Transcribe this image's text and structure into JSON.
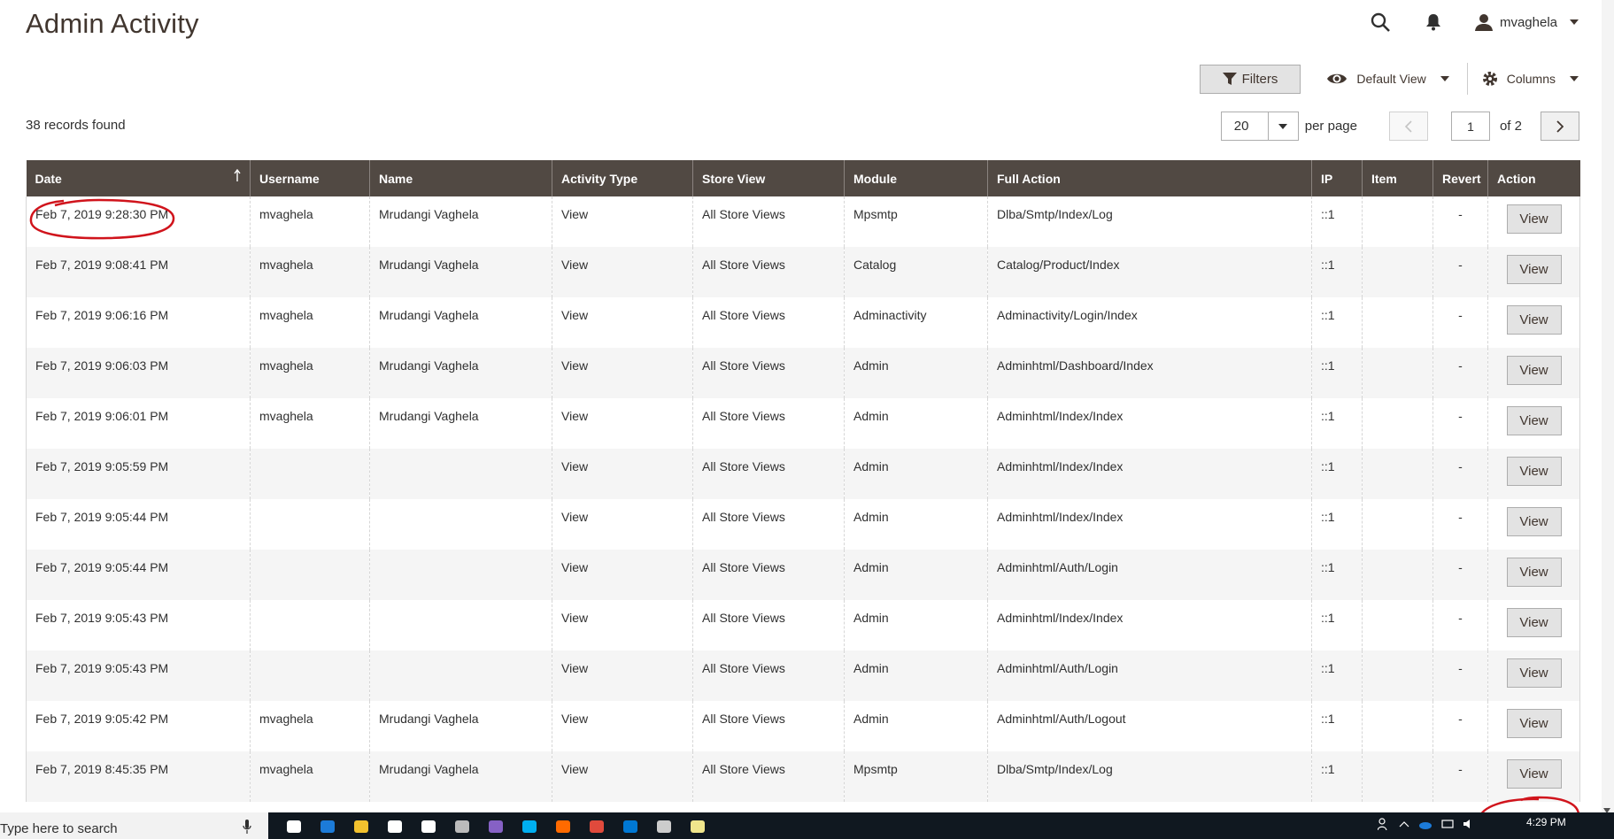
{
  "header": {
    "title": "Admin Activity",
    "username": "mvaghela"
  },
  "toolbar": {
    "filters_label": "Filters",
    "view_label": "Default View",
    "columns_label": "Columns"
  },
  "records_found": "38 records found",
  "pager": {
    "per_page_value": "20",
    "per_page_label": "per page",
    "current_page": "1",
    "of_label": "of 2"
  },
  "table": {
    "columns": [
      "Date",
      "Username",
      "Name",
      "Activity Type",
      "Store View",
      "Module",
      "Full Action",
      "IP",
      "Item",
      "Revert",
      "Action"
    ],
    "action_label": "View",
    "rows": [
      {
        "date": "Feb 7, 2019 9:28:30 PM",
        "username": "mvaghela",
        "name": "Mrudangi Vaghela",
        "type": "View",
        "store": "All Store Views",
        "module": "Mpsmtp",
        "action": "Dlba/Smtp/Index/Log",
        "ip": "::1",
        "item": "",
        "revert": "-"
      },
      {
        "date": "Feb 7, 2019 9:08:41 PM",
        "username": "mvaghela",
        "name": "Mrudangi Vaghela",
        "type": "View",
        "store": "All Store Views",
        "module": "Catalog",
        "action": "Catalog/Product/Index",
        "ip": "::1",
        "item": "",
        "revert": "-"
      },
      {
        "date": "Feb 7, 2019 9:06:16 PM",
        "username": "mvaghela",
        "name": "Mrudangi Vaghela",
        "type": "View",
        "store": "All Store Views",
        "module": "Adminactivity",
        "action": "Adminactivity/Login/Index",
        "ip": "::1",
        "item": "",
        "revert": "-"
      },
      {
        "date": "Feb 7, 2019 9:06:03 PM",
        "username": "mvaghela",
        "name": "Mrudangi Vaghela",
        "type": "View",
        "store": "All Store Views",
        "module": "Admin",
        "action": "Adminhtml/Dashboard/Index",
        "ip": "::1",
        "item": "",
        "revert": "-"
      },
      {
        "date": "Feb 7, 2019 9:06:01 PM",
        "username": "mvaghela",
        "name": "Mrudangi Vaghela",
        "type": "View",
        "store": "All Store Views",
        "module": "Admin",
        "action": "Adminhtml/Index/Index",
        "ip": "::1",
        "item": "",
        "revert": "-"
      },
      {
        "date": "Feb 7, 2019 9:05:59 PM",
        "username": "",
        "name": "",
        "type": "View",
        "store": "All Store Views",
        "module": "Admin",
        "action": "Adminhtml/Index/Index",
        "ip": "::1",
        "item": "",
        "revert": "-"
      },
      {
        "date": "Feb 7, 2019 9:05:44 PM",
        "username": "",
        "name": "",
        "type": "View",
        "store": "All Store Views",
        "module": "Admin",
        "action": "Adminhtml/Index/Index",
        "ip": "::1",
        "item": "",
        "revert": "-"
      },
      {
        "date": "Feb 7, 2019 9:05:44 PM",
        "username": "",
        "name": "",
        "type": "View",
        "store": "All Store Views",
        "module": "Admin",
        "action": "Adminhtml/Auth/Login",
        "ip": "::1",
        "item": "",
        "revert": "-"
      },
      {
        "date": "Feb 7, 2019 9:05:43 PM",
        "username": "",
        "name": "",
        "type": "View",
        "store": "All Store Views",
        "module": "Admin",
        "action": "Adminhtml/Index/Index",
        "ip": "::1",
        "item": "",
        "revert": "-"
      },
      {
        "date": "Feb 7, 2019 9:05:43 PM",
        "username": "",
        "name": "",
        "type": "View",
        "store": "All Store Views",
        "module": "Admin",
        "action": "Adminhtml/Auth/Login",
        "ip": "::1",
        "item": "",
        "revert": "-"
      },
      {
        "date": "Feb 7, 2019 9:05:42 PM",
        "username": "mvaghela",
        "name": "Mrudangi Vaghela",
        "type": "View",
        "store": "All Store Views",
        "module": "Admin",
        "action": "Adminhtml/Auth/Logout",
        "ip": "::1",
        "item": "",
        "revert": "-"
      },
      {
        "date": "Feb 7, 2019 8:45:35 PM",
        "username": "mvaghela",
        "name": "Mrudangi Vaghela",
        "type": "View",
        "store": "All Store Views",
        "module": "Mpsmtp",
        "action": "Dlba/Smtp/Index/Log",
        "ip": "::1",
        "item": "",
        "revert": "-"
      }
    ]
  },
  "taskbar": {
    "search_placeholder": "Type here to search",
    "time": "4:29 PM",
    "icons": [
      "task-view-icon",
      "edge-icon",
      "file-explorer-icon",
      "store-icon",
      "mail-icon",
      "app-icon",
      "app-icon-2",
      "skype-icon",
      "cloud-icon",
      "chrome-icon",
      "outlook-icon",
      "terminal-icon",
      "notepad-icon"
    ]
  },
  "colors": {
    "header_bg": "#514943",
    "annotation": "#d0141c",
    "taskbar": "#101820"
  }
}
